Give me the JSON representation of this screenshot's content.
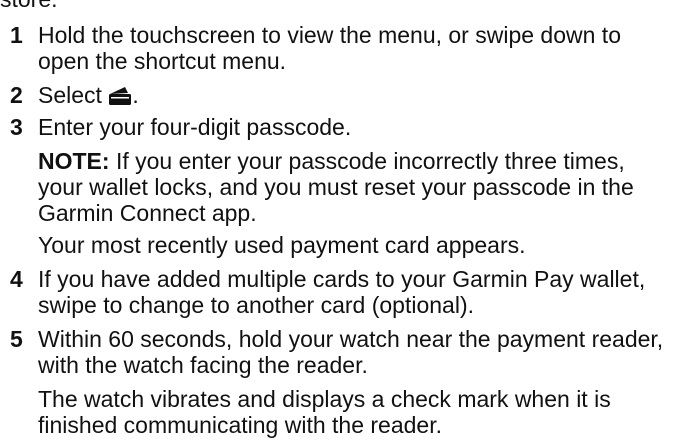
{
  "heading_fragment": "store.",
  "steps": [
    {
      "number": "1",
      "line1": "Hold the touchscreen to view the menu, or swipe down to",
      "line2": "open the shortcut menu."
    },
    {
      "number": "2",
      "before_icon": "Select ",
      "icon": "wallet-icon",
      "after_icon": "."
    },
    {
      "number": "3",
      "text": "Enter your four-digit passcode.",
      "note_label": "NOTE:",
      "note_line1": " If you enter your passcode incorrectly three times,",
      "note_line2": "your wallet locks, and you must reset your passcode in the",
      "note_line3": "Garmin Connect app.",
      "result": "Your most recently used payment card appears."
    },
    {
      "number": "4",
      "line1": "If you have added multiple cards to your Garmin Pay wallet,",
      "line2": "swipe to change to another card (optional)."
    },
    {
      "number": "5",
      "line1": "Within 60 seconds, hold your watch near the payment reader,",
      "line2": "with the watch facing the reader.",
      "result_line1": "The watch vibrates and displays a check mark when it is",
      "result_line2": "finished communicating with the reader."
    }
  ],
  "colors": {
    "text": "#111111",
    "background": "#ffffff"
  }
}
